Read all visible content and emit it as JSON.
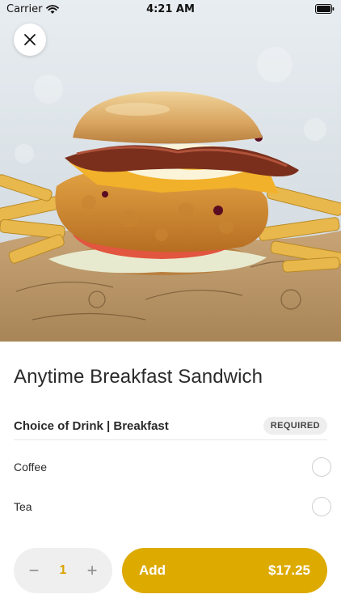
{
  "status_bar": {
    "carrier": "Carrier",
    "time": "4:21 AM"
  },
  "hero": {
    "image_subject": "breakfast-sandwich-photo"
  },
  "item": {
    "title": "Anytime Breakfast Sandwich"
  },
  "section": {
    "title": "Choice of Drink | Breakfast",
    "badge": "REQUIRED"
  },
  "options": [
    {
      "label": "Coffee",
      "selected": false
    },
    {
      "label": "Tea",
      "selected": false
    }
  ],
  "quantity": {
    "value": "1",
    "minus": "−",
    "plus": "+"
  },
  "add_button": {
    "label": "Add",
    "price": "$17.25"
  },
  "colors": {
    "accent": "#ddaa00",
    "stepper_bg": "#efefef",
    "quantity_text": "#d9a300"
  }
}
